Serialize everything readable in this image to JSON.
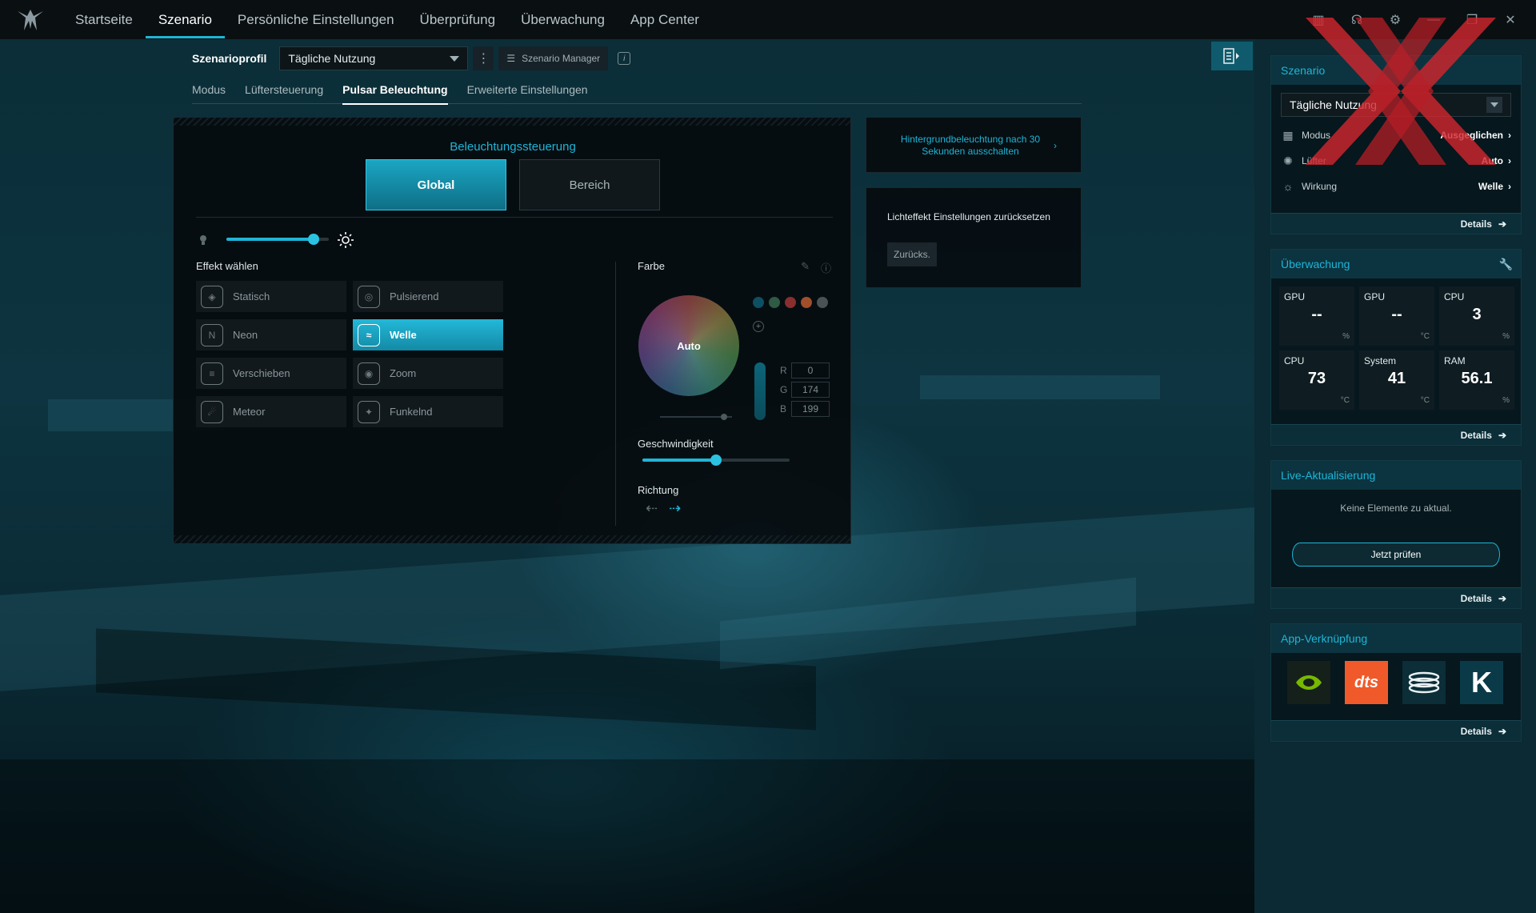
{
  "nav": {
    "items": [
      "Startseite",
      "Szenario",
      "Persönliche Einstellungen",
      "Überprüfung",
      "Überwachung",
      "App Center"
    ],
    "active_index": 1
  },
  "profile": {
    "label": "Szenarioprofil",
    "value": "Tägliche Nutzung",
    "manager_label": "Szenario Manager"
  },
  "subtabs": {
    "items": [
      "Modus",
      "Lüftersteuerung",
      "Pulsar Beleuchtung",
      "Erweiterte Einstellungen"
    ],
    "active_index": 2
  },
  "lighting": {
    "title": "Beleuchtungssteuerung",
    "modes": [
      "Global",
      "Bereich"
    ],
    "active_mode": "Global",
    "brightness_fraction": 0.85,
    "effects_label": "Effekt wählen",
    "effects": [
      "Statisch",
      "Pulsierend",
      "Neon",
      "Welle",
      "Verschieben",
      "Zoom",
      "Meteor",
      "Funkelnd"
    ],
    "active_effect": "Welle",
    "color_label": "Farbe",
    "wheel_label": "Auto",
    "swatches": [
      "#0d4f63",
      "#2f5a44",
      "#8a2e2e",
      "#a04f2a",
      "#4a5256"
    ],
    "rgb": {
      "R": "0",
      "G": "174",
      "B": "199"
    },
    "speed_label": "Geschwindigkeit",
    "speed_fraction": 0.5,
    "direction_label": "Richtung"
  },
  "cards": {
    "backlight_text": "Hintergrundbeleuchtung nach 30 Sekunden ausschalten",
    "reset_text": "Lichteffekt Einstellungen zurücksetzen",
    "reset_button": "Zurücks."
  },
  "sidebar": {
    "scenario": {
      "title": "Szenario",
      "value": "Tägliche Nutzung",
      "rows": [
        {
          "label": "Modus",
          "value": "Ausgeglichen"
        },
        {
          "label": "Lüfter",
          "value": "Auto"
        },
        {
          "label": "Wirkung",
          "value": "Welle"
        }
      ]
    },
    "monitor": {
      "title": "Überwachung",
      "cells": [
        {
          "label": "GPU",
          "value": "--",
          "unit": "%"
        },
        {
          "label": "GPU",
          "value": "--",
          "unit": "°C"
        },
        {
          "label": "CPU",
          "value": "3",
          "unit": "%"
        },
        {
          "label": "CPU",
          "value": "73",
          "unit": "°C"
        },
        {
          "label": "System",
          "value": "41",
          "unit": "°C"
        },
        {
          "label": "RAM",
          "value": "56.1",
          "unit": "%"
        }
      ]
    },
    "live": {
      "title": "Live-Aktualisierung",
      "message": "Keine Elemente zu aktual.",
      "button": "Jetzt prüfen"
    },
    "apps": {
      "title": "App-Verknüpfung",
      "items": [
        "nvidia",
        "dts",
        "stack",
        "K"
      ]
    },
    "details_label": "Details"
  }
}
